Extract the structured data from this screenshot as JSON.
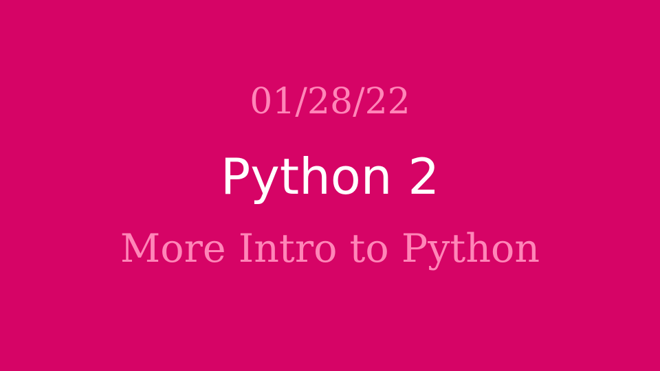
{
  "slide": {
    "date": "01/28/22",
    "title": "Python 2",
    "subtitle": "More Intro to Python"
  },
  "colors": {
    "background": "#d60466",
    "accent_text": "#ff86b8",
    "title_text": "#ffffff"
  }
}
